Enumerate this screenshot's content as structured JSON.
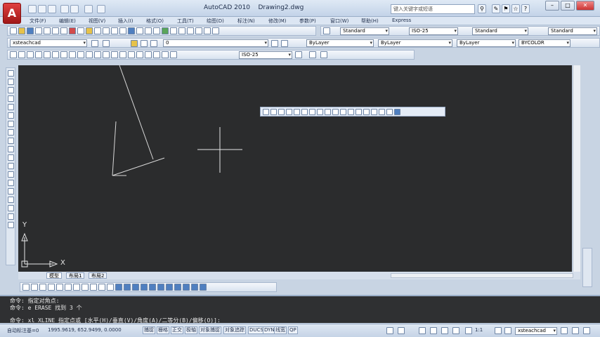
{
  "app": {
    "logo": "A",
    "title": "AutoCAD 2010",
    "document": "Drawing2.dwg"
  },
  "search": {
    "placeholder": "键入关键字或短语"
  },
  "menu": [
    "文件(F)",
    "编辑(E)",
    "视图(V)",
    "插入(I)",
    "格式(O)",
    "工具(T)",
    "绘图(D)",
    "标注(N)",
    "修改(M)",
    "参数(P)",
    "窗口(W)",
    "帮助(H)",
    "Express"
  ],
  "toolbar1": {
    "text_style": "Standard",
    "dim_style": "ISO-25",
    "table_style": "Standard",
    "ml_style": "Standard"
  },
  "toolbar2": {
    "workspace": "xsteachcad",
    "layer": "0",
    "color": "ByLayer",
    "linetype": "ByLayer",
    "lineweight": "ByLayer",
    "plotstyle": "BYCOLOR"
  },
  "toolbar3": {
    "dim_style": "ISO-25"
  },
  "tabs": {
    "model": "模型",
    "layout1": "布局1",
    "layout2": "布局2"
  },
  "ucs": {
    "x": "X",
    "y": "Y"
  },
  "command": {
    "line1": "命令: 指定对角点:",
    "line2": "命令: e ERASE 找到 3 个",
    "line3": "命令: xl XLINE 指定点或 [水平(H)/垂直(V)/角度(A)/二等分(B)/偏移(O)]:"
  },
  "status": {
    "label": "自动标注基=0",
    "coords": "1995.9619, 652.9499, 0.0000",
    "toggles": [
      "捕捉",
      "栅格",
      "正交",
      "极轴",
      "对象捕捉",
      "对象追踪",
      "DUCS",
      "DYN",
      "线宽",
      "QP"
    ],
    "scale": "1:1",
    "workspace": "xsteachcad"
  }
}
